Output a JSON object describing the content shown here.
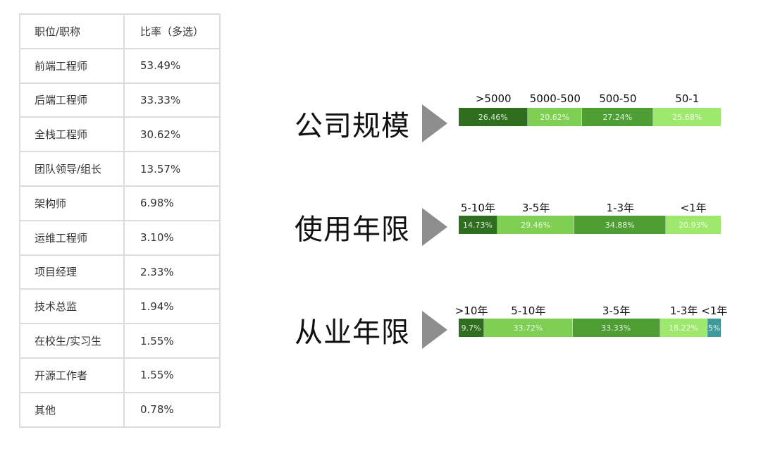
{
  "table": {
    "headers": [
      "职位/职称",
      "比率（多选）"
    ],
    "rows": [
      [
        "前端工程师",
        "53.49%"
      ],
      [
        "后端工程师",
        "33.33%"
      ],
      [
        "全栈工程师",
        "30.62%"
      ],
      [
        "团队领导/组长",
        "13.57%"
      ],
      [
        "架构师",
        "6.98%"
      ],
      [
        "运维工程师",
        "3.10%"
      ],
      [
        "项目经理",
        "2.33%"
      ],
      [
        "技术总监",
        "1.94%"
      ],
      [
        "在校生/实习生",
        "1.55%"
      ],
      [
        "开源工作者",
        "1.55%"
      ],
      [
        "其他",
        "0.78%"
      ]
    ]
  },
  "chart_data": [
    {
      "type": "table",
      "title": "职位/职称",
      "columns": [
        "职位/职称",
        "比率（多选）"
      ],
      "categories": [
        "前端工程师",
        "后端工程师",
        "全栈工程师",
        "团队领导/组长",
        "架构师",
        "运维工程师",
        "项目经理",
        "技术总监",
        "在校生/实习生",
        "开源工作者",
        "其他"
      ],
      "values": [
        53.49,
        33.33,
        30.62,
        13.57,
        6.98,
        3.1,
        2.33,
        1.94,
        1.55,
        1.55,
        0.78
      ]
    },
    {
      "type": "bar",
      "stacked": true,
      "title": "公司规模",
      "categories": [
        ">5000",
        "5000-500",
        "500-50",
        "50-1"
      ],
      "values": [
        26.46,
        20.62,
        27.24,
        25.68
      ],
      "labels": [
        "26.46%",
        "20.62%",
        "27.24%",
        "25.68%"
      ],
      "colors": [
        "#2f6e1f",
        "#7fcf55",
        "#4f9e33",
        "#9ee86e"
      ]
    },
    {
      "type": "bar",
      "stacked": true,
      "title": "使用年限",
      "categories": [
        "5-10年",
        "3-5年",
        "1-3年",
        "<1年"
      ],
      "values": [
        14.73,
        29.46,
        34.88,
        20.93
      ],
      "labels": [
        "14.73%",
        "29.46%",
        "34.88%",
        "20.93%"
      ],
      "colors": [
        "#2f6e1f",
        "#7fcf55",
        "#4f9e33",
        "#9ee86e"
      ]
    },
    {
      "type": "bar",
      "stacked": true,
      "title": "从业年限",
      "categories": [
        ">10年",
        "5-10年",
        "3-5年",
        "1-3年",
        "<1年"
      ],
      "values": [
        9.7,
        33.72,
        33.33,
        18.22,
        5
      ],
      "labels": [
        "9.7%",
        "33.72%",
        "33.33%",
        "18.22%",
        "5%"
      ],
      "colors": [
        "#2f6e1f",
        "#7fcf55",
        "#4f9e33",
        "#9ee86e",
        "#3f9a9a"
      ]
    }
  ]
}
